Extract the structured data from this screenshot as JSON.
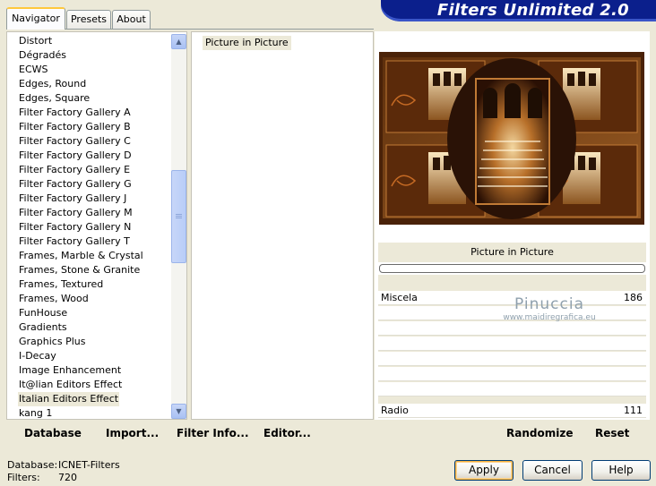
{
  "banner": {
    "title": "Filters Unlimited 2.0"
  },
  "tabs": [
    {
      "label": "Navigator",
      "active": true
    },
    {
      "label": "Presets",
      "active": false
    },
    {
      "label": "About",
      "active": false
    }
  ],
  "categories": [
    {
      "label": "Distort"
    },
    {
      "label": "Dégradés"
    },
    {
      "label": "ECWS"
    },
    {
      "label": "Edges, Round"
    },
    {
      "label": "Edges, Square"
    },
    {
      "label": "Filter Factory Gallery A"
    },
    {
      "label": "Filter Factory Gallery B"
    },
    {
      "label": "Filter Factory Gallery C"
    },
    {
      "label": "Filter Factory Gallery D"
    },
    {
      "label": "Filter Factory Gallery E"
    },
    {
      "label": "Filter Factory Gallery G"
    },
    {
      "label": "Filter Factory Gallery J"
    },
    {
      "label": "Filter Factory Gallery M"
    },
    {
      "label": "Filter Factory Gallery N"
    },
    {
      "label": "Filter Factory Gallery T"
    },
    {
      "label": "Frames, Marble & Crystal"
    },
    {
      "label": "Frames, Stone & Granite"
    },
    {
      "label": "Frames, Textured"
    },
    {
      "label": "Frames, Wood"
    },
    {
      "label": "FunHouse"
    },
    {
      "label": "Gradients"
    },
    {
      "label": "Graphics Plus"
    },
    {
      "label": "I-Decay"
    },
    {
      "label": "Image Enhancement"
    },
    {
      "label": "It@lian Editors Effect"
    },
    {
      "label": "Italian Editors Effect",
      "selected": true
    },
    {
      "label": "kang 1"
    }
  ],
  "filters": {
    "selected": "Picture in Picture"
  },
  "preview": {
    "filter_title": "Picture in Picture"
  },
  "controls": [
    {
      "label": "Miscela",
      "value": "186"
    },
    {
      "label": "Radio",
      "value": "111"
    }
  ],
  "watermark": {
    "name": "Pinuccia",
    "url": "www.maidiregrafica.eu"
  },
  "left_buttons": {
    "database": "Database",
    "import": "Import...",
    "filter_info": "Filter Info...",
    "editor": "Editor..."
  },
  "right_buttons": {
    "randomize": "Randomize",
    "reset": "Reset"
  },
  "status": {
    "database_label": "Database:",
    "database_value": "ICNET-Filters",
    "filters_label": "Filters:",
    "filters_value": "720"
  },
  "dialog_buttons": {
    "apply": "Apply",
    "cancel": "Cancel",
    "help": "Help"
  },
  "colors": {
    "accent": "#0b1f8c",
    "tab_highlight": "#ffc83c",
    "window_bg": "#ece9d8"
  }
}
